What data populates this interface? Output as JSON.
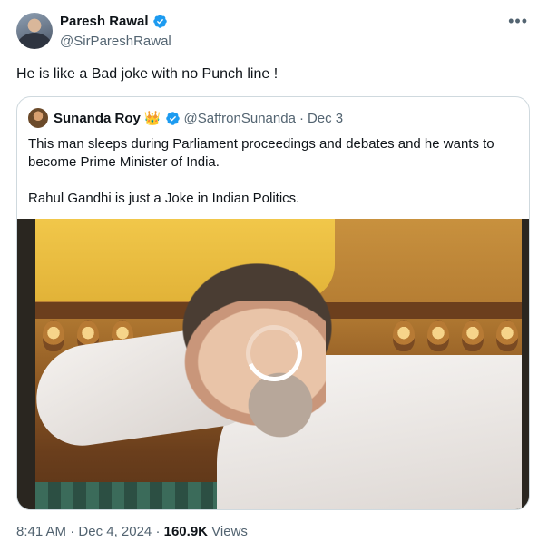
{
  "author": {
    "display_name": "Paresh Rawal",
    "handle": "@SirPareshRawal"
  },
  "tweet": {
    "text": "He is like a Bad joke with no Punch line !",
    "time": "8:41 AM",
    "date": "Dec 4, 2024",
    "views_count": "160.9K",
    "views_label": "Views",
    "separator": "·"
  },
  "quote": {
    "display_name": "Sunanda Roy",
    "badge": "👑",
    "handle": "@SaffronSunanda",
    "separator": "·",
    "date": "Dec 3",
    "paragraph_1": "This man sleeps during Parliament proceedings and debates and he wants to become Prime Minister of India.",
    "paragraph_2": "Rahul Gandhi is just a Joke in Indian Politics."
  },
  "icons": {
    "verified": "verified-badge-icon",
    "more": "more-options-icon",
    "loading": "loading-spinner-icon"
  },
  "colors": {
    "text_primary": "#0f1419",
    "text_secondary": "#536471",
    "verified_blue": "#1d9bf0",
    "border": "#cfd9de"
  }
}
